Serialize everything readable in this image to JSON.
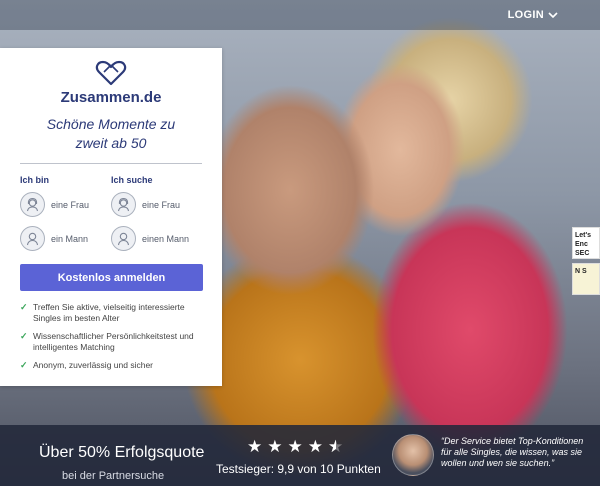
{
  "header": {
    "login_label": "LOGIN",
    "login_icon": "chevron-down-icon"
  },
  "card": {
    "brand": "Zusammen.de",
    "logo_icon": "heart-logo-icon",
    "tagline_line1": "Schöne Momente zu",
    "tagline_line2": "zweit ab 50",
    "i_am": {
      "heading": "Ich bin",
      "options": [
        {
          "label": "eine Frau",
          "icon": "woman-avatar-icon"
        },
        {
          "label": "ein Mann",
          "icon": "man-avatar-icon"
        }
      ]
    },
    "looking_for": {
      "heading": "Ich suche",
      "options": [
        {
          "label": "eine Frau",
          "icon": "woman-avatar-icon"
        },
        {
          "label": "einen Mann",
          "icon": "man-avatar-icon"
        }
      ]
    },
    "cta_label": "Kostenlos anmelden",
    "features": [
      {
        "line1": "Treffen Sie aktive, vielseitig interessierte",
        "line2": "Singles im besten Alter"
      },
      {
        "line1": "Wissenschaftlicher Persönlichkeitstest und",
        "line2": "intelligentes Matching"
      },
      {
        "line1": "Anonym, zuverlässig und sicher",
        "line2": ""
      }
    ]
  },
  "badges": {
    "badge_a": "Let's Enc SEC",
    "badge_b": "N S"
  },
  "bottom": {
    "success_big": "Über 50% Erfolgsquote",
    "success_small": "bei der Partnersuche",
    "rating_stars": 4.5,
    "test_winner": "Testsieger: 9,9 von 10 Punkten",
    "quote": "“Der Service bietet Top-Konditionen für alle Singles, die wissen, was sie wollen und wen sie suchen.”"
  },
  "colors": {
    "accent": "#5b63d6",
    "brand": "#2c3a78",
    "check": "#3aa55a",
    "footer_bg": "#22283a"
  }
}
